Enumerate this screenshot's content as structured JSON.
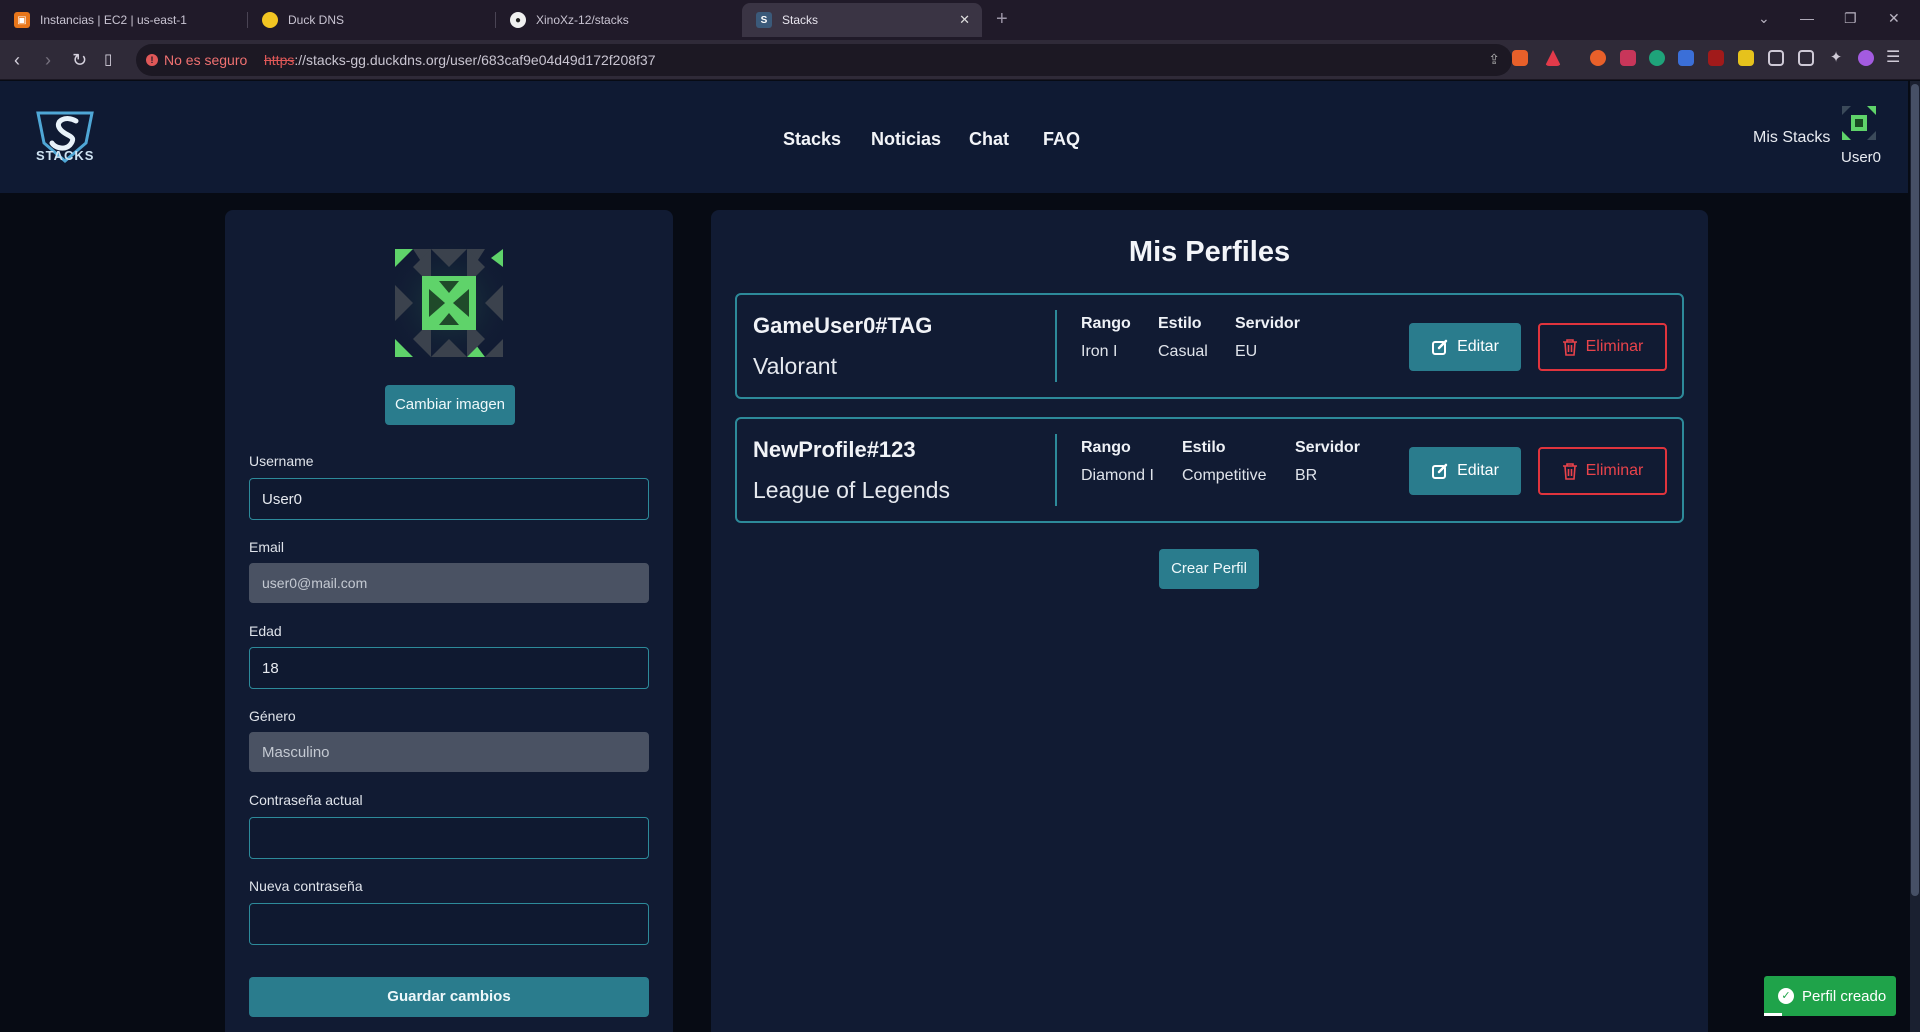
{
  "browser": {
    "tabs": [
      {
        "title": "Instancias | EC2 | us-east-1"
      },
      {
        "title": "Duck DNS"
      },
      {
        "title": "XinoXz-12/stacks"
      },
      {
        "title": "Stacks"
      }
    ],
    "security_label": "No es seguro",
    "url_scheme": "https",
    "url_rest": "://stacks-gg.duckdns.org/user/683caf9e04d49d172f208f37"
  },
  "header": {
    "logo_text": "STACKS",
    "nav": [
      "Stacks",
      "Noticias",
      "Chat",
      "FAQ"
    ],
    "mis_stacks": "Mis Stacks",
    "username": "User0"
  },
  "profile_form": {
    "change_image_label": "Cambiar imagen",
    "username_label": "Username",
    "username_value": "User0",
    "email_label": "Email",
    "email_value": "user0@mail.com",
    "edad_label": "Edad",
    "edad_value": "18",
    "genero_label": "Género",
    "genero_value": "Masculino",
    "current_password_label": "Contraseña actual",
    "new_password_label": "Nueva contraseña",
    "save_label": "Guardar cambios"
  },
  "profiles_panel": {
    "title": "Mis Perfiles",
    "profiles": [
      {
        "name": "GameUser0#TAG",
        "game": "Valorant",
        "rango_label": "Rango",
        "rango": "Iron I",
        "estilo_label": "Estilo",
        "estilo": "Casual",
        "servidor_label": "Servidor",
        "servidor": "EU",
        "edit_label": "Editar",
        "delete_label": "Eliminar"
      },
      {
        "name": "NewProfile#123",
        "game": "League of Legends",
        "rango_label": "Rango",
        "rango": "Diamond I",
        "estilo_label": "Estilo",
        "estilo": "Competitive",
        "servidor_label": "Servidor",
        "servidor": "BR",
        "edit_label": "Editar",
        "delete_label": "Eliminar"
      }
    ],
    "create_label": "Crear Perfil"
  },
  "toast": {
    "message": "Perfil creado"
  },
  "colors": {
    "accent": "#2a7c8d",
    "danger": "#e0343d",
    "success": "#1fa34a",
    "panel": "#111b33"
  }
}
